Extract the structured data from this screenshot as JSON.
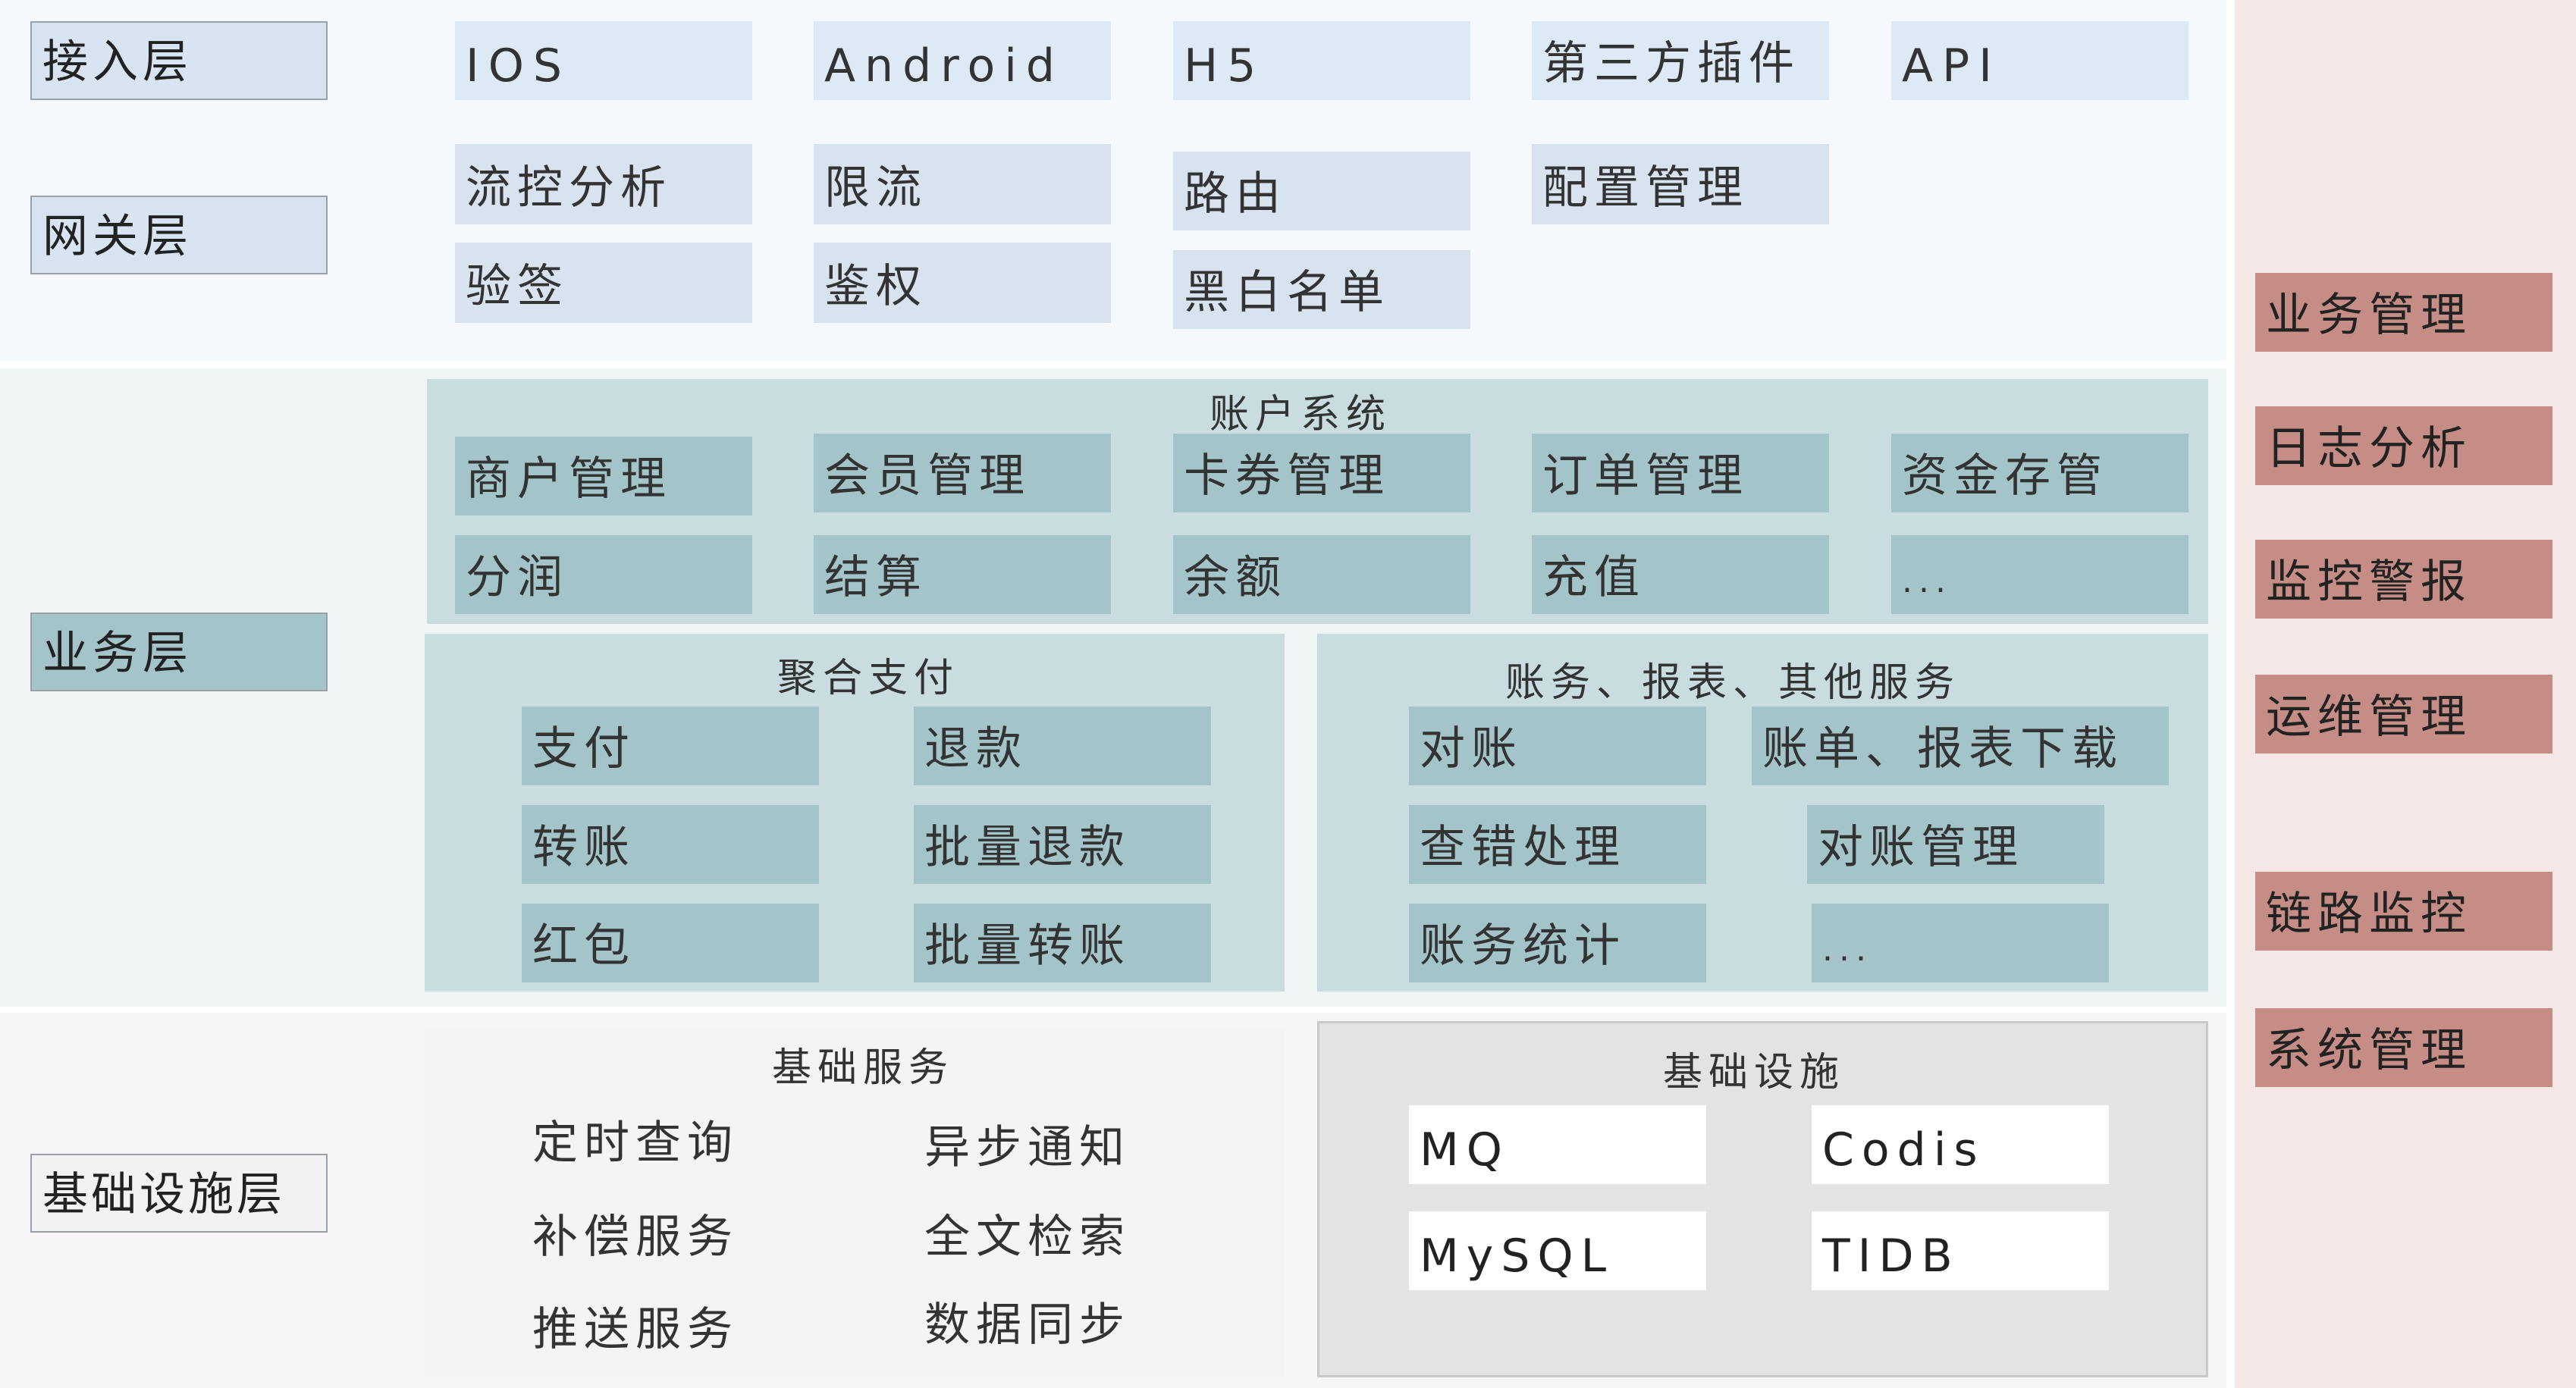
{
  "layers": {
    "access": {
      "label": "接入层",
      "items": [
        "IOS",
        "Android",
        "H5",
        "第三方插件",
        "API"
      ]
    },
    "gateway": {
      "label": "网关层",
      "items": [
        "流控分析",
        "验签",
        "限流",
        "鉴权",
        "路由",
        "黑白名单",
        "配置管理"
      ]
    },
    "business": {
      "label": "业务层",
      "account": {
        "title": "账户系统",
        "items": [
          "商户管理",
          "会员管理",
          "卡券管理",
          "订单管理",
          "资金存管",
          "分润",
          "结算",
          "余额",
          "充值",
          "..."
        ]
      },
      "aggregate_payment": {
        "title": "聚合支付",
        "items": [
          "支付",
          "退款",
          "转账",
          "批量退款",
          "红包",
          "批量转账"
        ]
      },
      "accounting": {
        "title": "账务、报表、其他服务",
        "items": [
          "对账",
          "账单、报表下载",
          "查错处理",
          "对账管理",
          "账务统计",
          "..."
        ]
      }
    },
    "infrastructure": {
      "label": "基础设施层",
      "base_services": {
        "title": "基础服务",
        "items": [
          "定时查询",
          "异步通知",
          "补偿服务",
          "全文检索",
          "推送服务",
          "数据同步"
        ]
      },
      "facilities": {
        "title": "基础设施",
        "items": [
          "MQ",
          "Codis",
          "MySQL",
          "TIDB"
        ]
      }
    }
  },
  "side_panel": {
    "items": [
      "业务管理",
      "日志分析",
      "监控警报",
      "运维管理",
      "链路监控",
      "系统管理"
    ]
  },
  "colors": {
    "access_bg": "#f5f9fd",
    "box_blue": "#dde9f5",
    "box_teal": "#a3c4c8",
    "group_teal": "#c9dde0",
    "side_panel_bg": "#f5e7e6",
    "side_box": "#c58d86",
    "infra_group": "#e3e3e3"
  }
}
